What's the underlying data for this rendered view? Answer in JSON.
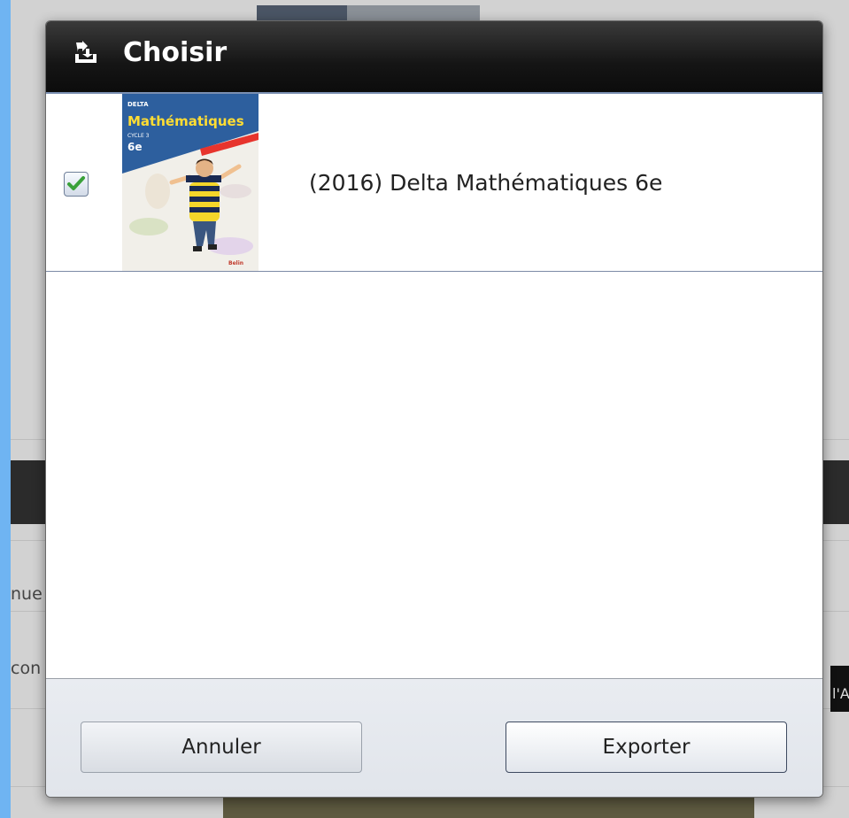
{
  "dialog": {
    "title": "Choisir",
    "title_icon": "export-arrow-icon"
  },
  "items": [
    {
      "checked": true,
      "label": "(2016) Delta Mathématiques 6e",
      "cover": {
        "brand": "DELTA",
        "subject": "Mathématiques",
        "cycle": "CYCLE 3",
        "grade": "6e",
        "publisher": "Belin"
      }
    }
  ],
  "footer": {
    "cancel_label": "Annuler",
    "export_label": "Exporter"
  },
  "background": {
    "fragment_left_1": "nue",
    "fragment_left_2": "con",
    "fragment_right_1": "l'A"
  },
  "colors": {
    "header_bg": "#151515",
    "accent_border": "#7a8fb2",
    "check_green": "#3aa13a",
    "outer_bg": "#6fb4f2"
  }
}
